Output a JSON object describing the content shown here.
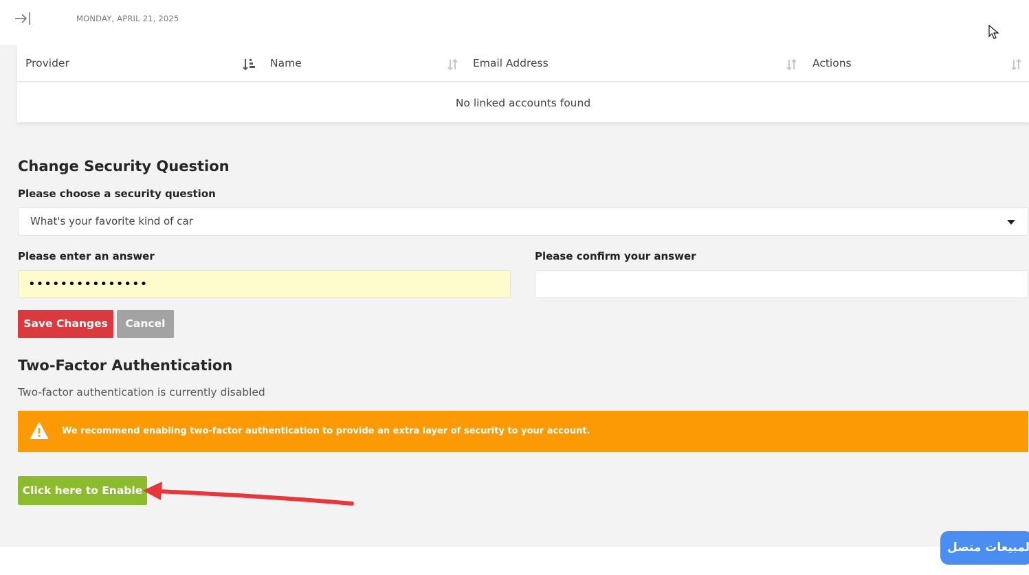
{
  "header": {
    "date": "MONDAY, APRIL 21, 2025"
  },
  "linked_accounts": {
    "columns": [
      "Provider",
      "Name",
      "Email Address",
      "Actions"
    ],
    "empty_message": "No linked accounts found"
  },
  "security_question": {
    "title": "Change Security Question",
    "choose_label": "Please choose a security question",
    "selected_question": "What's your favorite kind of car",
    "answer_label": "Please enter an answer",
    "answer_value": "•••••••••••••••",
    "confirm_label": "Please confirm your answer",
    "confirm_value": "",
    "save_label": "Save Changes",
    "cancel_label": "Cancel"
  },
  "two_factor": {
    "title": "Two-Factor Authentication",
    "status": "Two-factor authentication is currently disabled",
    "alert": "We recommend enabling two-factor authentication to provide an extra layer of security to your account.",
    "enable_label": "Click here to Enable"
  },
  "chat_widget": {
    "label": "المبيعات متصل"
  },
  "colors": {
    "save": "#da3a3d",
    "cancel": "#a3a3a3",
    "enable": "#8cbb2d",
    "alert": "#fb9a05",
    "answer_field": "#fefccd",
    "chat": "#4a8ef2",
    "annotation_arrow": "#e8363a"
  }
}
